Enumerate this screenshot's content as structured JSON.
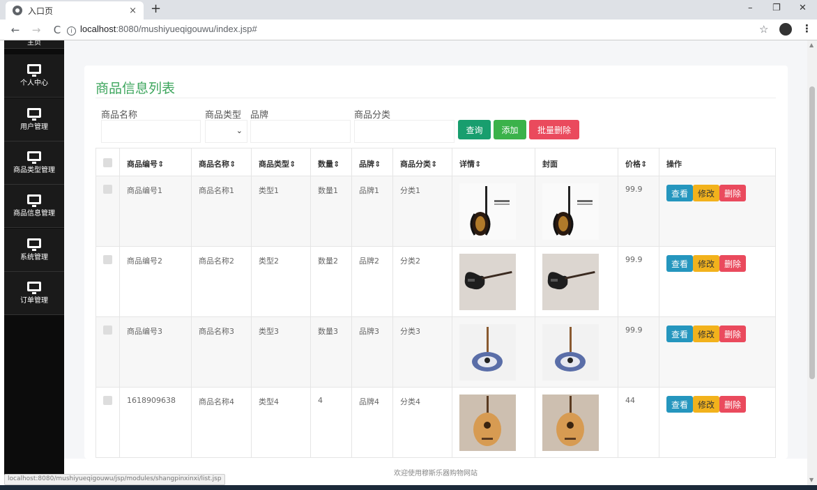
{
  "browser": {
    "tab_title": "入口页",
    "tab_close": "×",
    "new_tab": "+",
    "minimize": "–",
    "restore": "❐",
    "close": "✕",
    "back": "←",
    "forward": "→",
    "reload": "C",
    "url_info": "i",
    "url_host": "localhost",
    "url_rest": ":8080/mushiyueqigouwu/index.jsp#",
    "star": "☆",
    "menu": "⋮"
  },
  "sidebar": {
    "top_item": "主页",
    "items": [
      {
        "label": "个人中心",
        "icon": "monitor-icon"
      },
      {
        "label": "用户管理",
        "icon": "monitor-icon"
      },
      {
        "label": "商品类型管理",
        "icon": "monitor-icon"
      },
      {
        "label": "商品信息管理",
        "icon": "monitor-icon"
      },
      {
        "label": "系统管理",
        "icon": "monitor-icon"
      },
      {
        "label": "订单管理",
        "icon": "monitor-icon"
      }
    ]
  },
  "panel": {
    "title": "商品信息列表"
  },
  "filters": {
    "name_label": "商品名称",
    "type_label": "商品类型",
    "brand_label": "品牌",
    "category_label": "商品分类",
    "select_caret": "⌄"
  },
  "buttons": {
    "query": "查询",
    "add": "添加",
    "batch_delete": "批量删除"
  },
  "table": {
    "headers": {
      "code": "商品编号",
      "name": "商品名称",
      "type": "商品类型",
      "qty": "数量",
      "brand": "品牌",
      "category": "商品分类",
      "detail": "详情",
      "cover": "封面",
      "price": "价格",
      "ops": "操作"
    },
    "sort_icon": "⇕",
    "rows": [
      {
        "code": "商品编号1",
        "name": "商品名称1",
        "type": "类型1",
        "qty": "数量1",
        "brand": "品牌1",
        "category": "分类1",
        "price": "99.9"
      },
      {
        "code": "商品编号2",
        "name": "商品名称2",
        "type": "类型2",
        "qty": "数量2",
        "brand": "品牌2",
        "category": "分类2",
        "price": "99.9"
      },
      {
        "code": "商品编号3",
        "name": "商品名称3",
        "type": "类型3",
        "qty": "数量3",
        "brand": "品牌3",
        "category": "分类3",
        "price": "99.9"
      },
      {
        "code": "1618909638",
        "name": "商品名称4",
        "type": "类型4",
        "qty": "4",
        "brand": "品牌4",
        "category": "分类4",
        "price": "44"
      }
    ],
    "op_view": "查看",
    "op_edit": "修改",
    "op_delete": "删除"
  },
  "footer": {
    "text": "欢迎使用穆斯乐器购物网站"
  },
  "status_url": "localhost:8080/mushiyueqigouwu/jsp/modules/shangpinxinxi/list.jsp",
  "colors": {
    "title_green": "#3ca55c",
    "query": "#189e6e",
    "add": "#3bb24a",
    "batch_delete": "#ea4a5d",
    "view": "#2596be",
    "edit": "#f2b21c",
    "delete": "#ea4a5d",
    "sidebar_bg": "#0c0c0c"
  }
}
